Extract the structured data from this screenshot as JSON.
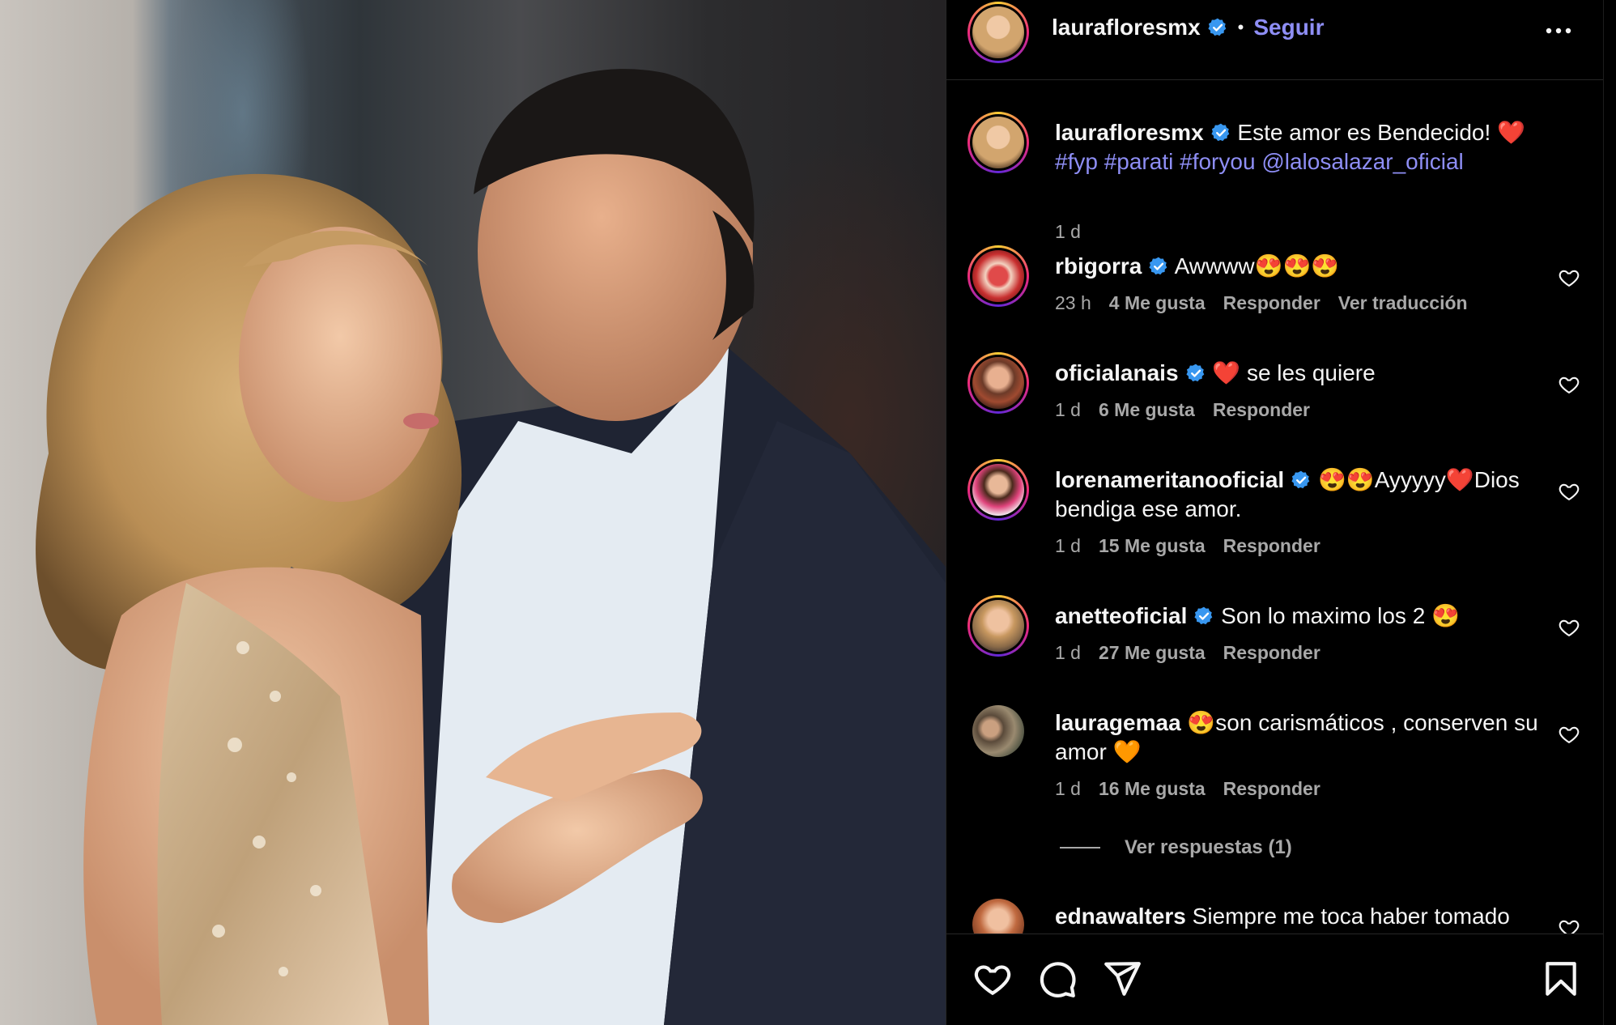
{
  "post": {
    "username": "laurafloresmx",
    "follow_label": "Seguir",
    "separator": "•",
    "caption": {
      "text": "Este amor es Bendecido! ❤️",
      "hashtags": [
        "#fyp",
        "#parati",
        "#foryou"
      ],
      "mention": "@lalosalazar_oficial",
      "time": "1 d"
    }
  },
  "comments": [
    {
      "username": "rbigorra",
      "verified": true,
      "text": "Awwww😍😍😍",
      "time": "23 h",
      "likes": "4 Me gusta",
      "reply": "Responder",
      "translate": "Ver traducción"
    },
    {
      "username": "oficialanais",
      "verified": true,
      "text": "❤️ se les quiere",
      "time": "1 d",
      "likes": "6 Me gusta",
      "reply": "Responder"
    },
    {
      "username": "lorenameritanooficial",
      "verified": true,
      "text": "😍😍Ayyyyy❤️Dios bendiga ese amor.",
      "time": "1 d",
      "likes": "15 Me gusta",
      "reply": "Responder"
    },
    {
      "username": "anetteoficial",
      "verified": true,
      "text": "Son lo maximo los 2 😍",
      "time": "1 d",
      "likes": "27 Me gusta",
      "reply": "Responder"
    },
    {
      "username": "lauragemaa",
      "verified": false,
      "text": "😍son carismáticos , conserven su amor 🧡",
      "time": "1 d",
      "likes": "16 Me gusta",
      "reply": "Responder"
    },
    {
      "username": "ednawalters",
      "verified": false,
      "text": "Siempre me toca haber tomado"
    }
  ],
  "view_replies": "Ver respuestas (1)",
  "icons": {
    "verified": "verified-badge-icon",
    "more": "more-options-icon",
    "like": "heart-icon",
    "comment": "comment-icon",
    "share": "share-icon",
    "save": "bookmark-icon"
  },
  "colors": {
    "link": "#8e8ef5",
    "verified": "#3897f0",
    "meta": "#a8a8a8",
    "background": "#000000"
  }
}
